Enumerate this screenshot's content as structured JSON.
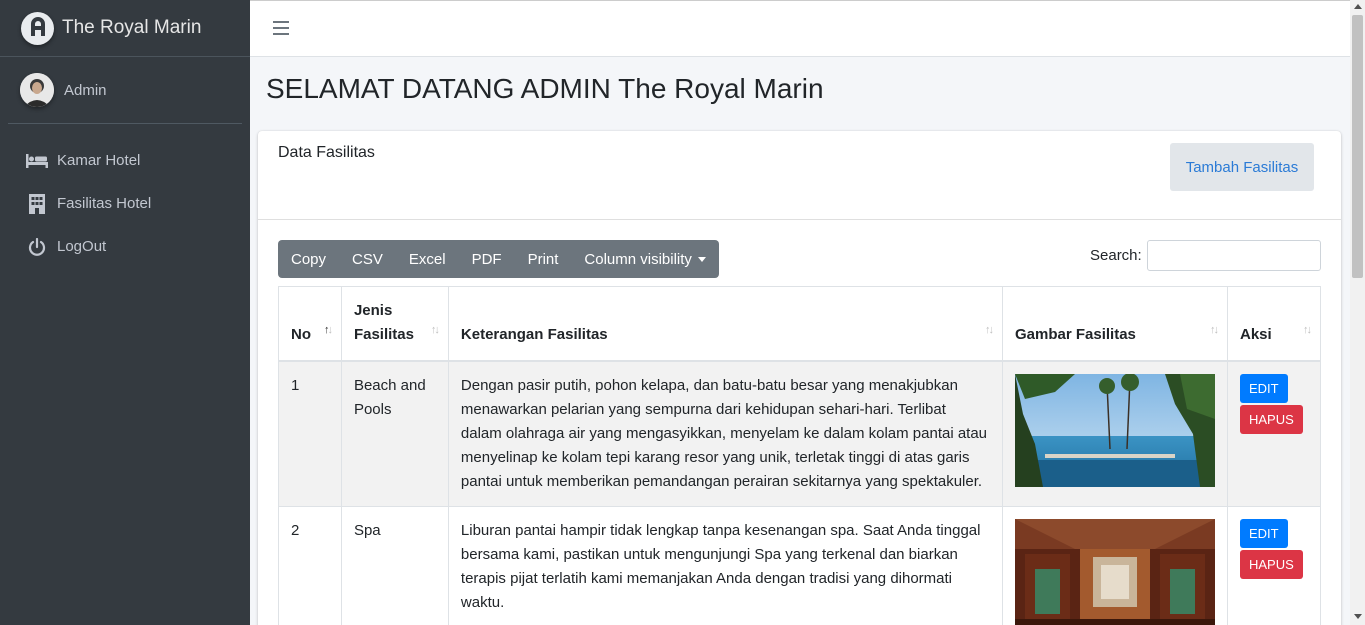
{
  "brand": {
    "name": "The Royal Marin"
  },
  "user": {
    "name": "Admin"
  },
  "sidebar": {
    "items": [
      {
        "label": "Kamar Hotel",
        "icon": "bed-icon"
      },
      {
        "label": "Fasilitas Hotel",
        "icon": "building-icon"
      },
      {
        "label": "LogOut",
        "icon": "power-icon"
      }
    ]
  },
  "page": {
    "title": "SELAMAT DATANG ADMIN The Royal Marin"
  },
  "card": {
    "title": "Data Fasilitas",
    "add_button": "Tambah Fasilitas"
  },
  "toolbar": {
    "copy": "Copy",
    "csv": "CSV",
    "excel": "Excel",
    "pdf": "PDF",
    "print": "Print",
    "column_visibility": "Column visibility"
  },
  "search": {
    "label": "Search:",
    "value": ""
  },
  "table": {
    "headers": {
      "no": "No",
      "jenis_line1": "Jenis",
      "jenis_line2": "Fasilitas",
      "keterangan": "Keterangan Fasilitas",
      "gambar": "Gambar Fasilitas",
      "aksi": "Aksi"
    },
    "rows": [
      {
        "no": "1",
        "jenis_line1": "Beach and",
        "jenis_line2": "Pools",
        "keterangan": "Dengan pasir putih, pohon kelapa, dan batu-batu besar yang menakjubkan menawarkan pelarian yang sempurna dari kehidupan sehari-hari. Terlibat dalam olahraga air yang mengasyikkan, menyelam ke dalam kolam pantai atau menyelinap ke kolam tepi karang resor yang unik, terletak tinggi di atas garis pantai untuk memberikan pemandangan perairan sekitarnya yang spektakuler.",
        "edit": "EDIT",
        "hapus": "HAPUS"
      },
      {
        "no": "2",
        "jenis_line1": "Spa",
        "jenis_line2": "",
        "keterangan": "Liburan pantai hampir tidak lengkap tanpa kesenangan spa. Saat Anda tinggal bersama kami, pastikan untuk mengunjungi Spa yang terkenal dan biarkan terapis pijat terlatih kami memanjakan Anda dengan tradisi yang dihormati waktu.",
        "edit": "EDIT",
        "hapus": "HAPUS"
      }
    ]
  }
}
